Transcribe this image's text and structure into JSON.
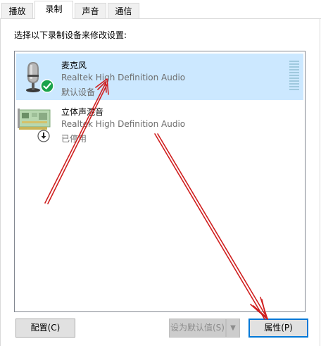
{
  "tabs": [
    {
      "label": "播放",
      "active": false
    },
    {
      "label": "录制",
      "active": true
    },
    {
      "label": "声音",
      "active": false
    },
    {
      "label": "通信",
      "active": false
    }
  ],
  "instruction": "选择以下录制设备来修改设置:",
  "devices": [
    {
      "name": "麦克风",
      "description": "Realtek High Definition Audio",
      "status": "默认设备",
      "icon": "microphone-icon",
      "badge": "default-check-icon",
      "selected": true
    },
    {
      "name": "立体声混音",
      "description": "Realtek High Definition Audio",
      "status": "已停用",
      "icon": "sound-card-icon",
      "badge": "disabled-down-arrow-icon",
      "selected": false
    }
  ],
  "buttons": {
    "configure": "配置(C)",
    "set_default": "设为默认值(S)",
    "properties": "属性(P)"
  },
  "colors": {
    "selected_row": "#cce8ff",
    "annotation_arrow": "#d02020",
    "check_badge": "#1aa34a"
  }
}
